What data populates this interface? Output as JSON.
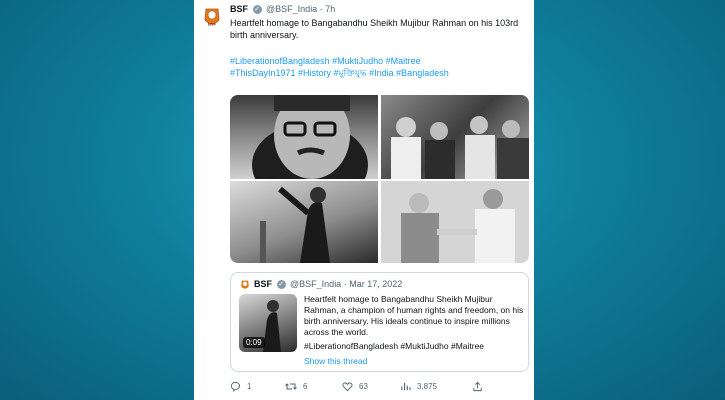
{
  "tweet": {
    "author": "BSF",
    "handle": "@BSF_India",
    "time": "· 7h",
    "avatar_text": "BSF",
    "text": "Heartfelt homage to Bangabandhu Sheikh Mujibur Rahman on his 103rd birth anniversary.",
    "hashtags_line1": "#LiberationofBangladesh #MuktiJudho #Maitree",
    "hashtags_line2": "#ThisDayIn1971 #History #মুক্তিযুদ্ধ #India #Bangladesh"
  },
  "quoted": {
    "author": "BSF",
    "handle": "@BSF_India",
    "date": "· Mar 17, 2022",
    "text": "Heartfelt homage to Bangabandhu Sheikh Mujibur Rahman, a champion of human rights and freedom, on his birth anniversary. His ideals continue to inspire millions across the world.",
    "hashtags": "#LiberationofBangladesh #MuktiJudho #Maitree",
    "video_duration": "0:09",
    "show_thread": "Show this thread"
  },
  "actions": {
    "replies": "1",
    "retweets": "6",
    "likes": "63",
    "views": "3,875"
  },
  "colors": {
    "background": "#0f7f9c",
    "link": "#1d9bf0",
    "text": "#0f1419",
    "muted": "#536471"
  }
}
